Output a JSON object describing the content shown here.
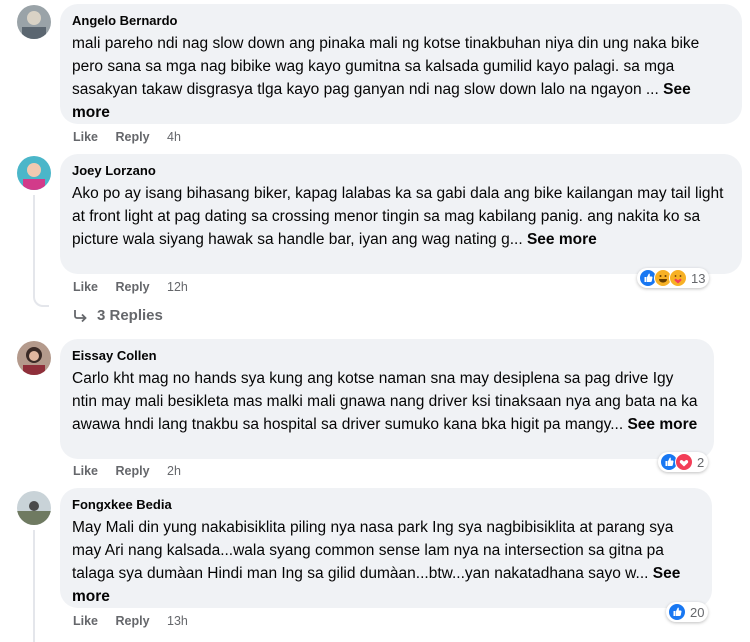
{
  "comments": [
    {
      "author": "Angelo Bernardo",
      "text": "mali pareho ndi nag slow down ang pinaka mali ng kotse tinakbuhan niya din ung naka bike pero sana sa mga nag bibike wag kayo gumitna sa kalsada gumilid kayo palagi. sa mga sasakyan takaw disgrasya tlga kayo pag ganyan ndi nag slow down lalo na ngayon ...",
      "see_more": "See more",
      "like": "Like",
      "reply": "Reply",
      "time": "4h",
      "reaction_count": null
    },
    {
      "author": "Joey Lorzano",
      "text": "Ako po ay isang bihasang biker, kapag lalabas ka sa gabi dala ang bike kailangan may tail light at front light at pag dating sa crossing menor tingin sa mag kabilang panig. ang nakita ko sa picture wala siyang hawak sa handle bar, iyan ang wag nating g...",
      "see_more": "See more",
      "like": "Like",
      "reply": "Reply",
      "time": "12h",
      "reaction_count": "13",
      "replies_label": "3 Replies"
    },
    {
      "author": "Eissay Collen",
      "text": "Carlo kht mag no hands sya kung ang kotse naman sna may desiplena sa pag drive Igy ntin may mali besikleta mas malki mali gnawa nang driver ksi tinaksaan nya ang bata na ka awawa hndi lang tnakbu sa hospital sa driver sumuko kana bka higit pa mangy...",
      "see_more": "See more",
      "like": "Like",
      "reply": "Reply",
      "time": "2h",
      "reaction_count": "2"
    },
    {
      "author": "Fongxkee Bedia",
      "text": "May Mali din yung nakabisiklita piling nya nasa park Ing sya nagbibisiklita at parang sya may Ari nang kalsada...wala syang common sense lam nya na intersection sa gitna pa talaga sya dumàan Hindi man Ing sa gilid dumàan...btw...yan nakatadhana sayo w...",
      "see_more": "See more",
      "like": "Like",
      "reply": "Reply",
      "time": "13h",
      "reaction_count": "20"
    }
  ],
  "colors": {
    "like_blue": "#1877f2",
    "haha_yellow": "#f7b125",
    "love_red": "#f33e58",
    "bubble": "#f0f2f5",
    "meta": "#65676b"
  },
  "icons": [
    "like-reaction-icon",
    "haha-reaction-icon",
    "care-reaction-icon",
    "love-reaction-icon",
    "reply-arrow-icon"
  ]
}
